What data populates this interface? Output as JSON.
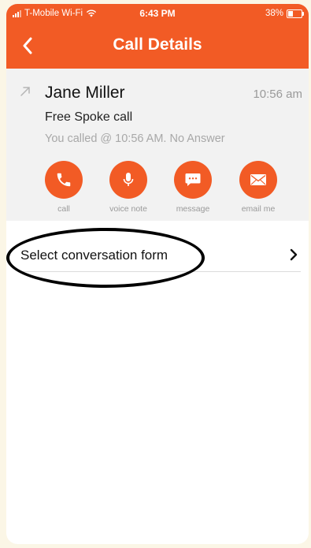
{
  "status_bar": {
    "carrier": "T-Mobile Wi-Fi",
    "time": "6:43 PM",
    "battery": "38%",
    "battery_level": 0.38
  },
  "nav": {
    "title": "Call Details",
    "back_icon": "chevron-left-icon"
  },
  "call": {
    "direction_icon": "outgoing-arrow-icon",
    "contact_name": "Jane Miller",
    "time": "10:56 am",
    "type": "Free Spoke call",
    "status": "You called @ 10:56 AM. No Answer"
  },
  "actions": [
    {
      "label": "call",
      "icon": "phone-icon"
    },
    {
      "label": "voice note",
      "icon": "microphone-icon"
    },
    {
      "label": "message",
      "icon": "message-icon"
    },
    {
      "label": "email me",
      "icon": "email-icon"
    }
  ],
  "form": {
    "label": "Select conversation form",
    "chevron_icon": "chevron-right-icon"
  },
  "colors": {
    "accent": "#f25b25",
    "details_bg": "#f2f2f2",
    "page_bg": "#fbf6e6"
  }
}
